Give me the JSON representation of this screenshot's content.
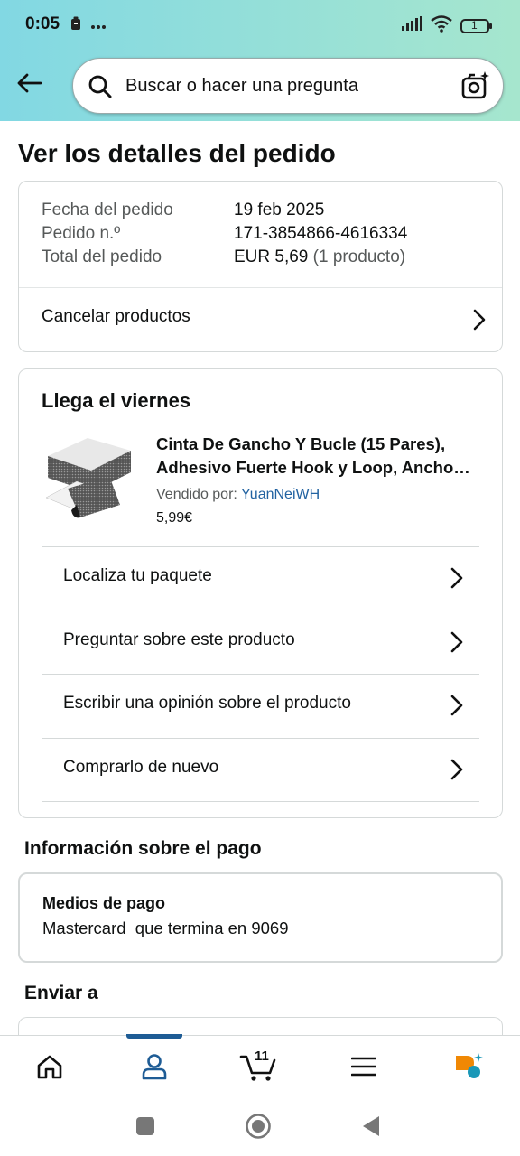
{
  "status_bar": {
    "time": "0:05",
    "battery": "1"
  },
  "search": {
    "placeholder": "Buscar o hacer una pregunta"
  },
  "page_title": "Ver los detalles del pedido",
  "order_summary": {
    "rows": [
      {
        "label": "Fecha del pedido",
        "value": "19 feb 2025"
      },
      {
        "label": "Pedido n.º",
        "value": "171-3854866-4616334"
      },
      {
        "label": "Total del pedido",
        "value": "EUR 5,69",
        "extra": "(1 producto)"
      }
    ],
    "cancel_label": "Cancelar productos"
  },
  "shipment": {
    "arrival": "Llega el viernes",
    "product": {
      "title_line1": "Cinta De Gancho Y Bucle (15 Pares),",
      "title_line2": "Adhesivo Fuerte Hook y Loop, Ancho…",
      "seller_prefix": "Vendido por:",
      "seller_name": "YuanNeiWH",
      "price": "5,99€"
    },
    "actions": [
      "Localiza tu paquete",
      "Preguntar sobre este producto",
      "Escribir una opinión sobre el producto",
      "Comprarlo de nuevo"
    ]
  },
  "payment": {
    "section_title": "Información sobre el pago",
    "method_title": "Medios de pago",
    "method_value": "Mastercard  que termina en 9069"
  },
  "shipping": {
    "section_title": "Enviar a"
  },
  "bottom_nav": {
    "cart_count": "11",
    "items": [
      "home-icon",
      "account-icon",
      "cart-icon",
      "menu-icon",
      "rufus-icon"
    ],
    "active": "account-icon"
  },
  "colors": {
    "header_start": "#82d8e3",
    "header_end": "#a6e6ce",
    "link": "#2162a1",
    "active_nav": "#1e5c95",
    "rufus_orange": "#f08804",
    "rufus_teal": "#1a98b8"
  }
}
